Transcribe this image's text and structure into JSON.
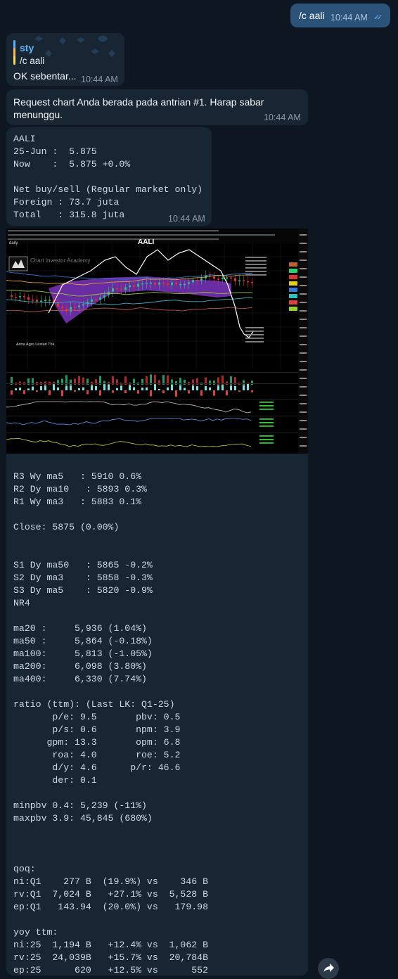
{
  "outgoing": {
    "text": "/c aali",
    "time": "10:44 AM",
    "status": "double-check-icon"
  },
  "reply": {
    "quoted_name": "sty",
    "quoted_text": "/c aali",
    "text": "OK sebentar...",
    "time": "10:44 AM"
  },
  "queue": {
    "text": "Request chart Anda berada pada antrian #1. Harap sabar menunggu.",
    "time": "10:44 AM"
  },
  "summary": {
    "text": "AALI\n25-Jun :  5.875\nNow    :  5.875 +0.0%\n\nNet buy/sell (Regular market only)\nForeign : 73.7 juta\nTotal   : 315.8 juta",
    "time": "10:44 AM"
  },
  "chart_image": {
    "ticker": "AALI",
    "watermark": "Chart Investor Academy",
    "company": "Astra Agro Lestari Tbk.",
    "period": "daily",
    "colors": {
      "up": "#26c281",
      "down": "#e0302f",
      "cloud": "#8c3bd9",
      "price": "#ffffff"
    }
  },
  "analysis": {
    "text": "R3 Wy ma5   : 5910 0.6%\nR2 Dy ma10   : 5893 0.3%\nR1 Wy ma3   : 5883 0.1%\n\nClose: 5875 (0.00%)\n\n\nS1 Dy ma50   : 5865 -0.2%\nS2 Dy ma3    : 5858 -0.3%\nS3 Dy ma5    : 5820 -0.9%\nNR4\n\nma20 :     5,936 (1.04%)\nma50 :     5,864 (-0.18%)\nma100:     5,813 (-1.05%)\nma200:     6,098 (3.80%)\nma400:     6,330 (7.74%)\n\nratio (ttm): (Last LK: Q1-25)\n       p/e: 9.5       pbv: 0.5\n       p/s: 0.6       npm: 3.9\n      gpm: 13.3       opm: 6.8\n       roa: 4.0       roe: 5.2\n       d/y: 4.6      p/r: 46.6\n       der: 0.1\n\nminpbv 0.4: 5,239 (-11%)\nmaxpbv 3.9: 45,845 (680%)\n\n\n\nqoq:\nni:Q1    277 B  (19.9%) vs    346 B\nrv:Q1  7,024 B   +27.1% vs  5,528 B\nep:Q1   143.94  (20.0%) vs   179.98\n\nyoy ttm:\nni:25  1,194 B   +12.4% vs  1,062 B\nrv:25  24,039B   +15.7% vs  20,784B\nep:25      620   +12.5% vs      552"
  }
}
